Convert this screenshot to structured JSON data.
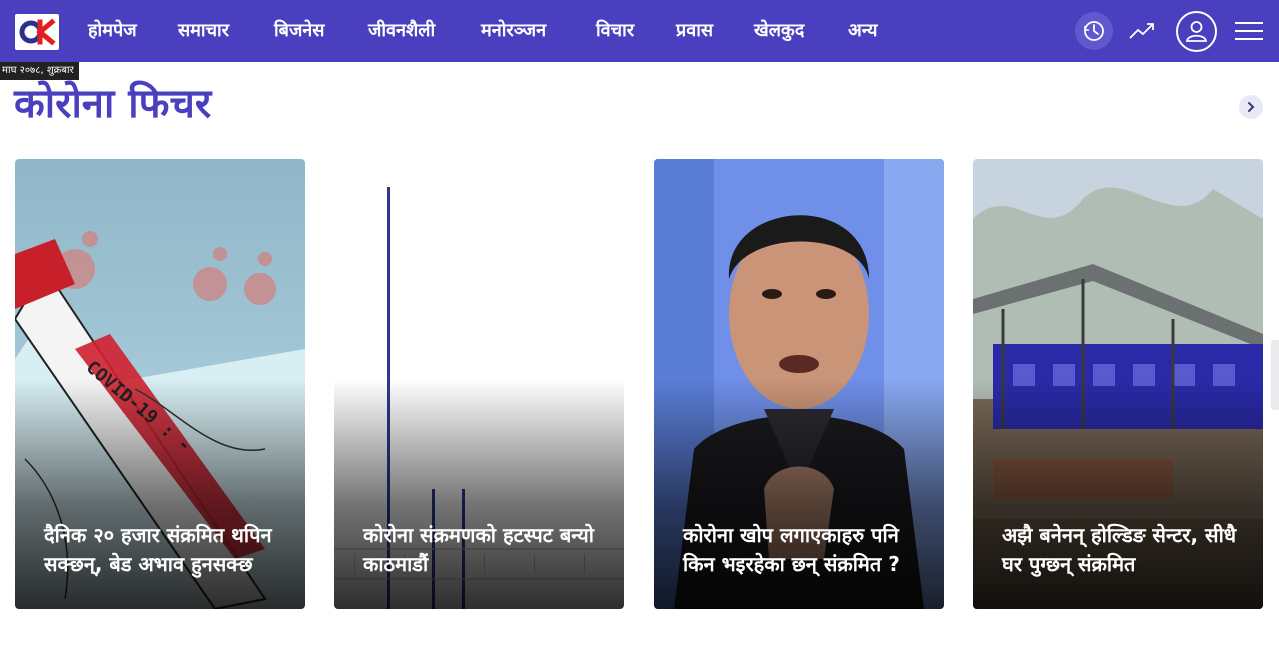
{
  "header": {
    "logo_text": "OK",
    "nav": [
      {
        "label": "होमपेज",
        "active": true
      },
      {
        "label": "समाचार",
        "active": false
      },
      {
        "label": "बिजनेस",
        "active": false
      },
      {
        "label": "जीवनशैली",
        "active": false
      },
      {
        "label": "मनोरञ्जन",
        "active": false
      },
      {
        "label": "विचार",
        "active": false
      },
      {
        "label": "प्रवास",
        "active": false
      },
      {
        "label": "खेलकुद",
        "active": false
      },
      {
        "label": "अन्य",
        "active": false
      }
    ],
    "icons": [
      "clock-icon",
      "trending-icon",
      "user-icon",
      "hamburger-menu-icon"
    ]
  },
  "date_tag": "माघ २०७८, शुक्रबार",
  "section": {
    "title": "कोरोना फिचर",
    "next_icon": "chevron-right-icon"
  },
  "cards": [
    {
      "headline": "दैनिक २० हजार संक्रमित थपिन सक्छन्, बेड अभाव हुनसक्छ",
      "image": "covid-19-test-tube-illustration"
    },
    {
      "headline": "कोरोना संक्रमणको हटस्पट बन्यो काठमाडौं",
      "image": "bar-graph-image"
    },
    {
      "headline": "कोरोना खोप लगाएकाहरु पनि किन भइरहेका छन् संक्रमित ?",
      "image": "man-speaking-portrait"
    },
    {
      "headline": "अझै बनेनन् होल्डिङ सेन्टर, सीधै घर पुग्छन् संक्रमित",
      "image": "construction-site-shed"
    }
  ],
  "colors": {
    "brand": "#4a3fbf",
    "nav_active": "#8ad0ff",
    "logo_red": "#e02020"
  }
}
